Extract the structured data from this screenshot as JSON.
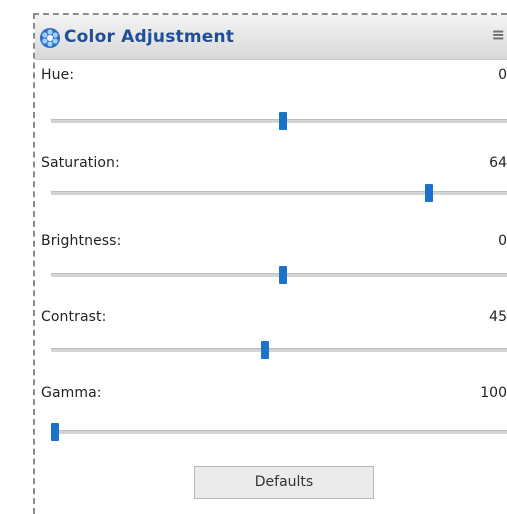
{
  "header": {
    "title": "Color Adjustment",
    "icon": "color-wheel-icon",
    "accent": "#1f4f99",
    "menu_glyph": "≡"
  },
  "sliders": [
    {
      "label": "Hue:",
      "value": "0",
      "min": -180,
      "max": 180,
      "current": 0
    },
    {
      "label": "Saturation:",
      "value": "64",
      "min": -100,
      "max": 100,
      "current": 64
    },
    {
      "label": "Brightness:",
      "value": "0",
      "min": -100,
      "max": 100,
      "current": 0
    },
    {
      "label": "Contrast:",
      "value": "45",
      "min": -100,
      "max": 100,
      "current": -8
    },
    {
      "label": "Gamma:",
      "value": "100",
      "min": 100,
      "max": 1000,
      "current": 100
    }
  ],
  "thumb_color": "#1a72c9",
  "defaults_label": "Defaults"
}
